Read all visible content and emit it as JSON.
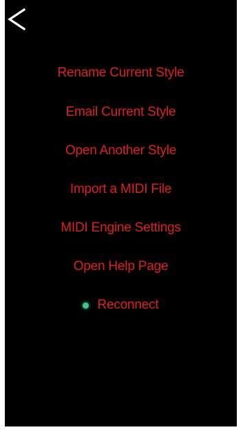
{
  "header": {
    "back_icon": "chevron-left-icon"
  },
  "menu": {
    "items": [
      {
        "label": "Rename Current Style"
      },
      {
        "label": "Email Current Style"
      },
      {
        "label": "Open Another Style"
      },
      {
        "label": "Import a MIDI File"
      },
      {
        "label": "MIDI Engine Settings"
      },
      {
        "label": "Open Help Page"
      }
    ],
    "reconnect": {
      "label": "Reconnect",
      "status_icon": "status-dot-icon",
      "status_color": "#3fc48a"
    }
  },
  "colors": {
    "background": "#000000",
    "text": "#e0201b",
    "back_icon": "#ffffff"
  }
}
